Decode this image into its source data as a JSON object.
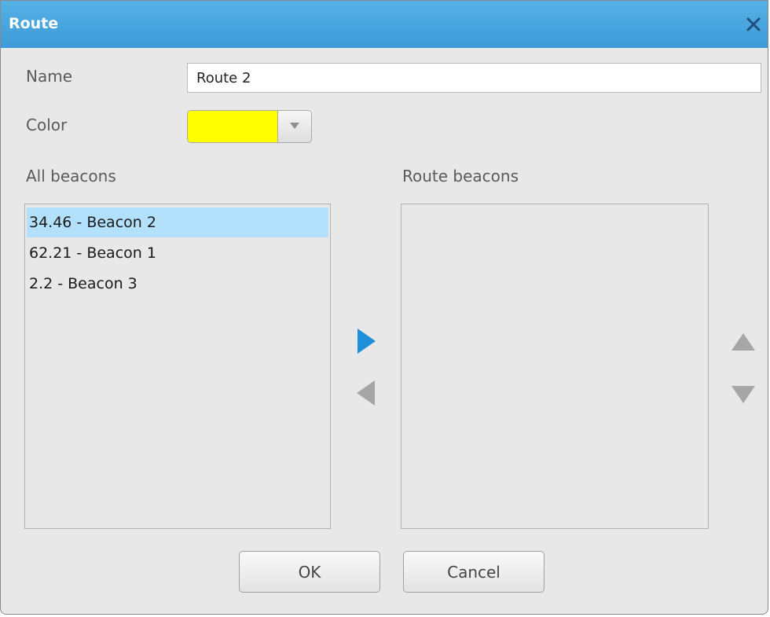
{
  "dialog": {
    "title": "Route"
  },
  "form": {
    "name_label": "Name",
    "name_value": "Route 2",
    "color_label": "Color",
    "color_value": "#ffff00"
  },
  "all_beacons": {
    "label": "All beacons",
    "items": [
      {
        "label": "34.46 - Beacon 2",
        "selected": true
      },
      {
        "label": "62.21 - Beacon 1",
        "selected": false
      },
      {
        "label": "2.2 - Beacon 3",
        "selected": false
      }
    ]
  },
  "route_beacons": {
    "label": "Route beacons",
    "items": []
  },
  "buttons": {
    "ok_label": "OK",
    "cancel_label": "Cancel"
  },
  "colors": {
    "titlebar": "#4aa7df",
    "accent": "#1e8fd8",
    "disabled_arrow": "#a6a6a6",
    "selection": "#b3e1fb"
  },
  "icons": {
    "close": "close-icon",
    "add": "triangle-right-icon",
    "remove": "triangle-left-icon",
    "move_up": "triangle-up-icon",
    "move_down": "triangle-down-icon",
    "dropdown": "chevron-down-icon"
  }
}
